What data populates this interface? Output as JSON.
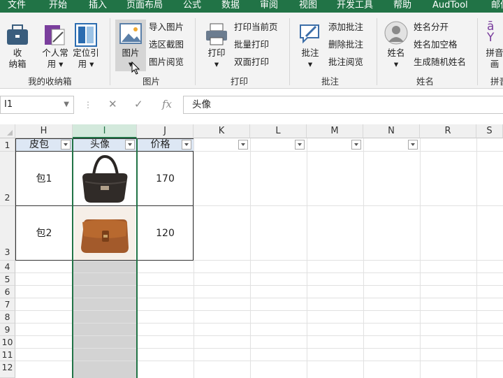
{
  "tabs": [
    "文件",
    "开始",
    "插入",
    "页面布局",
    "公式",
    "数据",
    "审阅",
    "视图",
    "开发工具",
    "帮助",
    "AudTool",
    "邮件"
  ],
  "ribbon": {
    "groups": [
      {
        "label": "我的收纳箱",
        "buttons": [
          "收\n纳箱",
          "个人常\n用 ▾",
          "定位引\n用 ▾"
        ]
      },
      {
        "label": "图片",
        "big": "图片\n▾",
        "items": [
          "导入图片",
          "选区截图",
          "图片阅览"
        ]
      },
      {
        "label": "打印",
        "big": "打印\n▾",
        "items": [
          "打印当前页",
          "批量打印",
          "双面打印"
        ]
      },
      {
        "label": "批注",
        "big": "批注\n▾",
        "items": [
          "添加批注",
          "删除批注",
          "批注阅览"
        ]
      },
      {
        "label": "姓名",
        "big": "姓名\n▾",
        "items": [
          "姓名分开",
          "姓名加空格",
          "生成随机姓名"
        ]
      },
      {
        "label": "拼音",
        "big": "拼音\n画",
        "icon_text": "ā\nY"
      }
    ]
  },
  "formula_bar": {
    "name_box": "I1",
    "fx": "fx",
    "cancel": "✕",
    "enter": "✓",
    "content": "头像"
  },
  "columns": [
    "H",
    "I",
    "J",
    "K",
    "L",
    "M",
    "N",
    "R",
    "S"
  ],
  "rows": [
    "1",
    "2",
    "3",
    "4",
    "5",
    "6",
    "7",
    "8",
    "9",
    "10",
    "11",
    "12"
  ],
  "table": {
    "headers": [
      "皮包",
      "头像",
      "价格"
    ],
    "rows": [
      {
        "name": "包1",
        "image": "black-handbag",
        "price": "170"
      },
      {
        "name": "包2",
        "image": "brown-satchel",
        "price": "120"
      }
    ]
  },
  "colors": {
    "excel_green": "#217346",
    "selection": "#d3d3d3",
    "sel_border": "#217346"
  }
}
